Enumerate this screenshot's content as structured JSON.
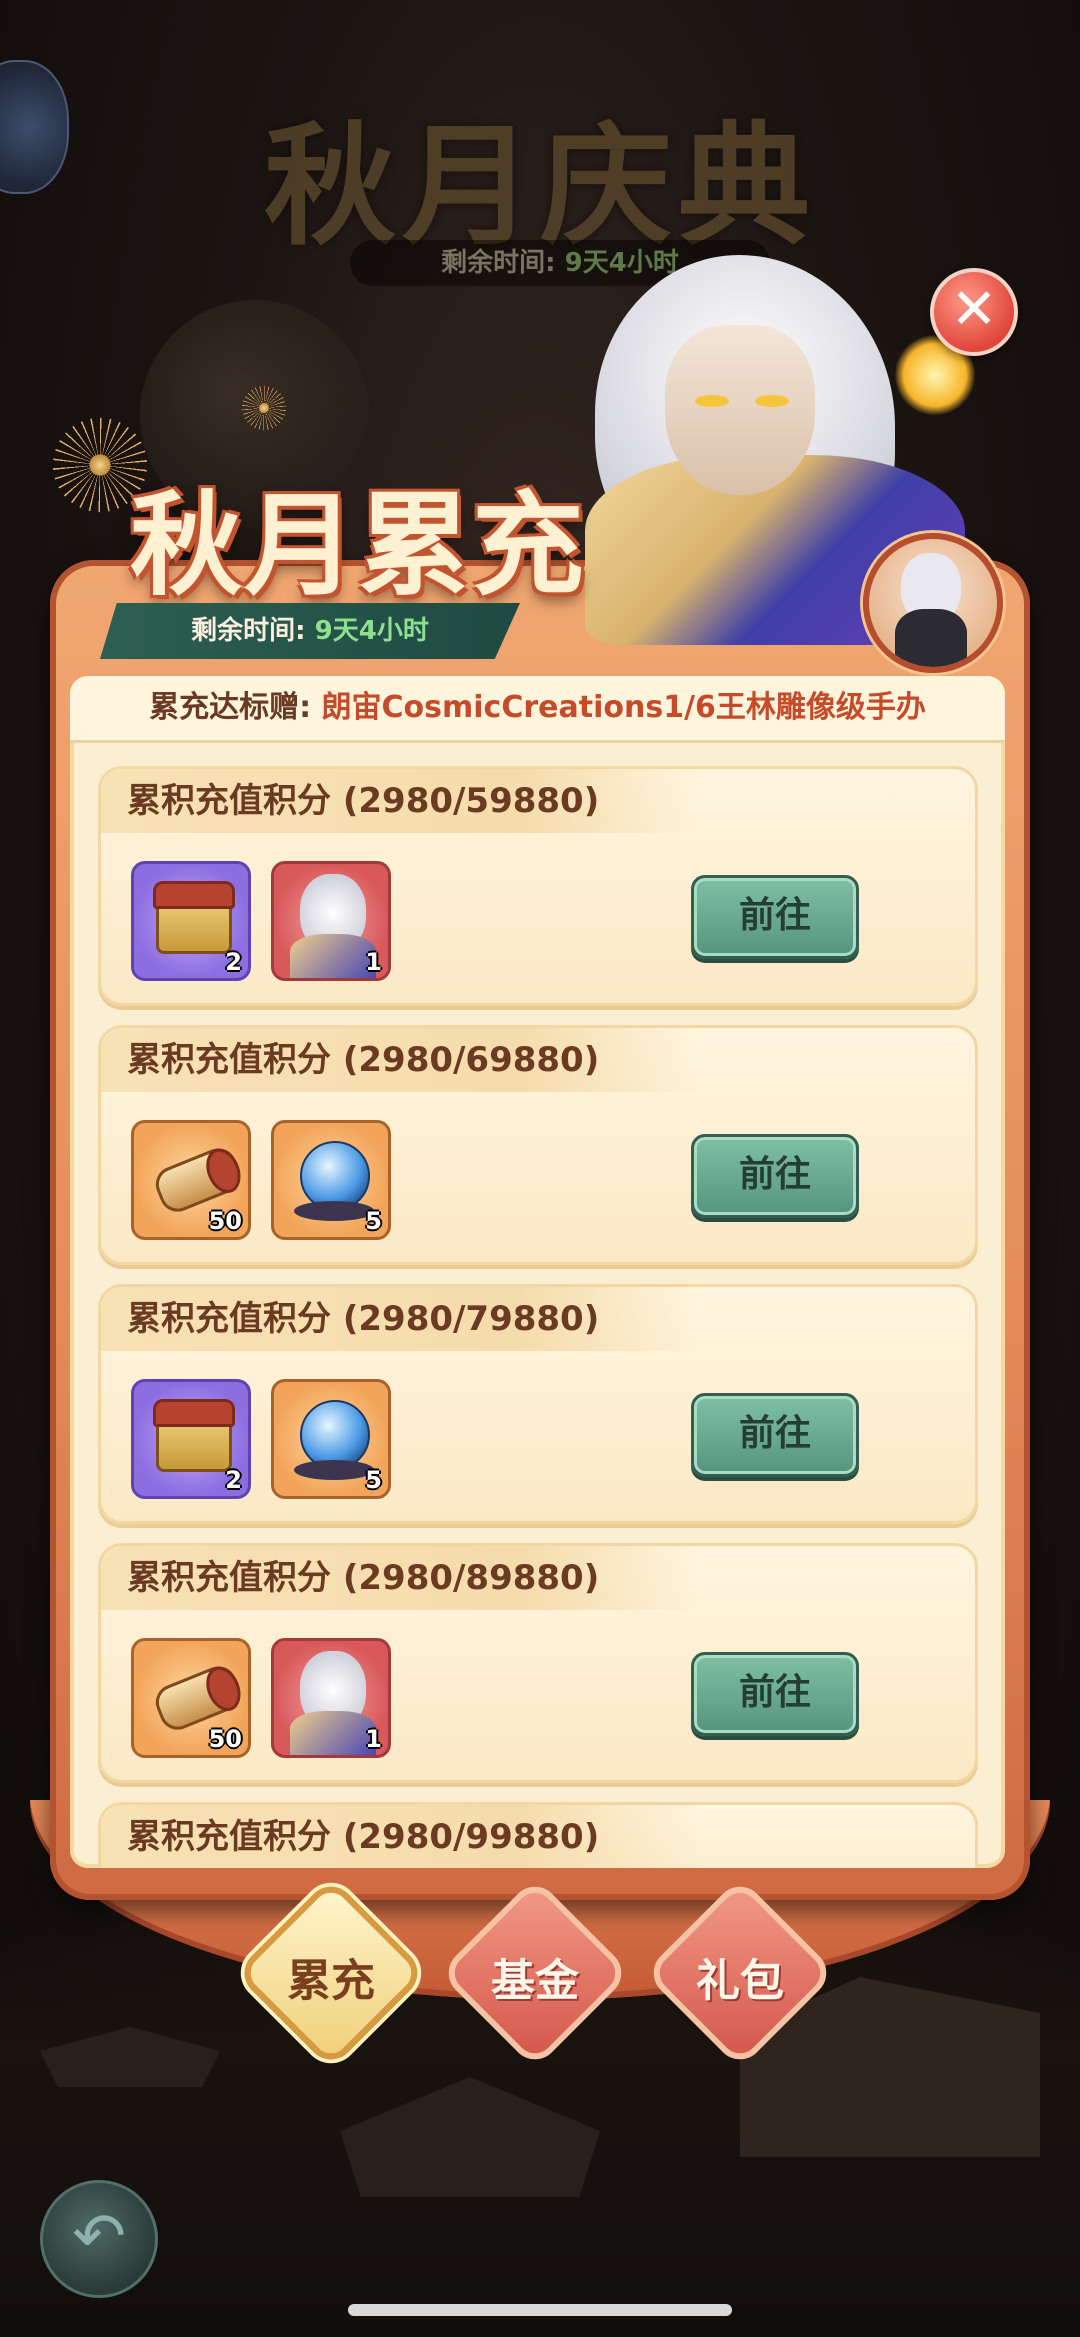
{
  "background": {
    "festival_title": "秋月庆典",
    "festival_time_label": "剩余时间:",
    "festival_time_value": "9天4小时"
  },
  "panel": {
    "title": "秋月累充",
    "time_label": "剩余时间:",
    "time_value": "9天4小时",
    "reward_banner_label": "累充达标赠:",
    "reward_banner_value": "朗宙CosmicCreations1/6王林雕像级手办"
  },
  "tiers": [
    {
      "label": "累积充值积分",
      "progress": "(2980/59880)",
      "button": "前往",
      "items": [
        {
          "icon": "gift-chest-icon",
          "count": "2",
          "color": "purple"
        },
        {
          "icon": "hero-portrait-icon",
          "count": "1",
          "color": "red"
        }
      ]
    },
    {
      "label": "累积充值积分",
      "progress": "(2980/69880)",
      "button": "前往",
      "items": [
        {
          "icon": "scroll-icon",
          "count": "50",
          "color": "orange"
        },
        {
          "icon": "spirit-orb-icon",
          "count": "5",
          "color": "orange"
        }
      ]
    },
    {
      "label": "累积充值积分",
      "progress": "(2980/79880)",
      "button": "前往",
      "items": [
        {
          "icon": "gift-chest-icon",
          "count": "2",
          "color": "purple"
        },
        {
          "icon": "spirit-orb-icon",
          "count": "5",
          "color": "orange"
        }
      ]
    },
    {
      "label": "累积充值积分",
      "progress": "(2980/89880)",
      "button": "前往",
      "items": [
        {
          "icon": "scroll-icon",
          "count": "50",
          "color": "orange"
        },
        {
          "icon": "hero-portrait-icon",
          "count": "1",
          "color": "red"
        }
      ]
    },
    {
      "label": "累积充值积分",
      "progress": "(2980/99880)"
    }
  ],
  "tabs": [
    {
      "label": "累充",
      "active": true
    },
    {
      "label": "基金",
      "active": false
    },
    {
      "label": "礼包",
      "active": false
    }
  ],
  "close_glyph": "✕",
  "back_glyph": "↶",
  "colors": {
    "panel": "#e58c5a",
    "inner": "#fbefd3",
    "button": "#6aa98f",
    "accent": "#c64b2b"
  }
}
